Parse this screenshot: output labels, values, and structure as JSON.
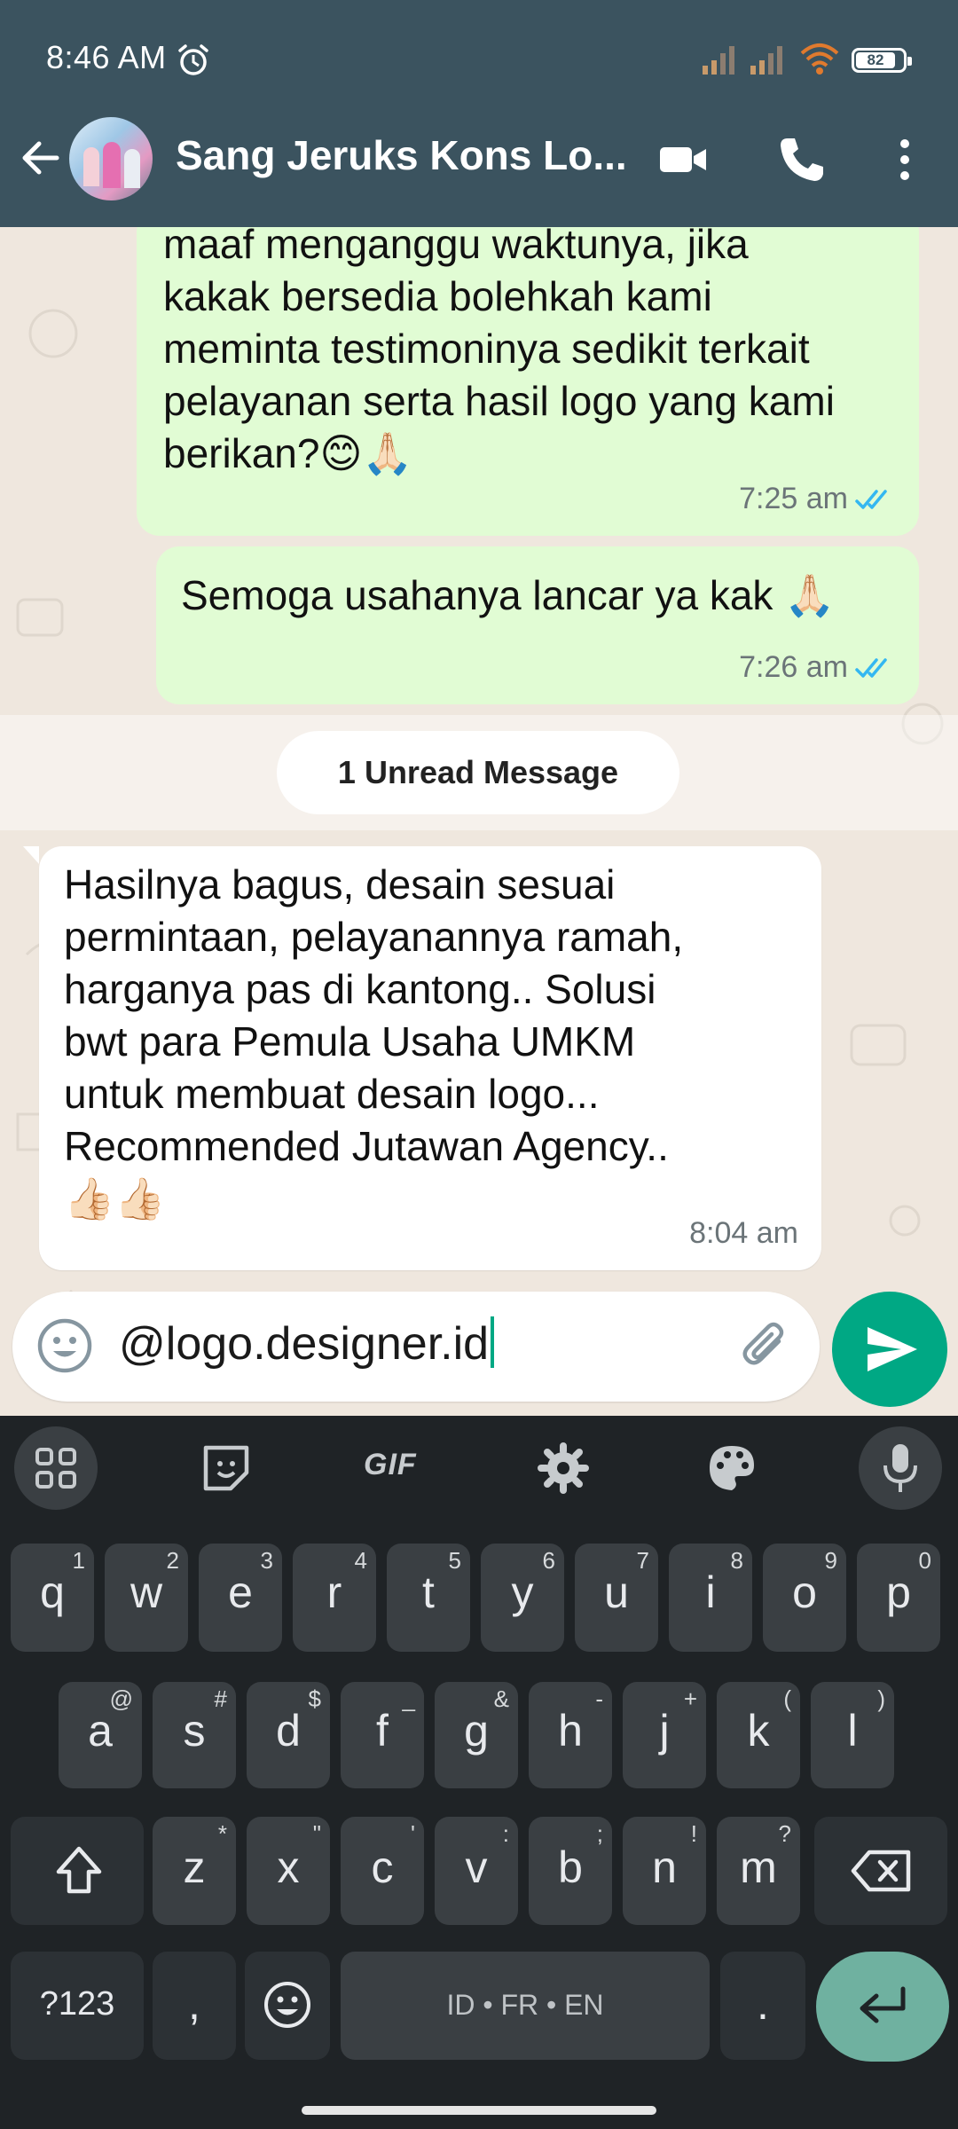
{
  "status_bar": {
    "time": "8:46 AM",
    "battery": "82"
  },
  "header": {
    "title": "Sang Jeruks Kons Lo..."
  },
  "messages": [
    {
      "direction": "out",
      "text": "maaf menganggu waktunya, jika\nkakak bersedia bolehkah kami\nmeminta testimoninya sedikit terkait\npelayanan serta hasil logo yang kami\nberikan?😊🙏🏻",
      "time": "7:25 am"
    },
    {
      "direction": "out",
      "text": "Semoga usahanya lancar ya kak 🙏🏻",
      "time": "7:26 am"
    },
    {
      "direction": "in",
      "text": "Hasilnya bagus, desain sesuai\npermintaan, pelayanannya ramah,\nharganya pas di kantong.. Solusi\nbwt para Pemula Usaha UMKM\nuntuk membuat desain logo...\nRecommended Jutawan Agency..\n👍🏻👍🏻",
      "time": "8:04 am"
    }
  ],
  "unread_banner": "1 Unread Message",
  "composer": {
    "value": "@logo.designer.id"
  },
  "keyboard": {
    "toolbar_gif": "GIF",
    "row1": [
      {
        "k": "q",
        "s": "1"
      },
      {
        "k": "w",
        "s": "2"
      },
      {
        "k": "e",
        "s": "3"
      },
      {
        "k": "r",
        "s": "4"
      },
      {
        "k": "t",
        "s": "5"
      },
      {
        "k": "y",
        "s": "6"
      },
      {
        "k": "u",
        "s": "7"
      },
      {
        "k": "i",
        "s": "8"
      },
      {
        "k": "o",
        "s": "9"
      },
      {
        "k": "p",
        "s": "0"
      }
    ],
    "row2": [
      {
        "k": "a",
        "s": "@"
      },
      {
        "k": "s",
        "s": "#"
      },
      {
        "k": "d",
        "s": "$"
      },
      {
        "k": "f",
        "s": "_"
      },
      {
        "k": "g",
        "s": "&"
      },
      {
        "k": "h",
        "s": "-"
      },
      {
        "k": "j",
        "s": "+"
      },
      {
        "k": "k",
        "s": "("
      },
      {
        "k": "l",
        "s": ")"
      }
    ],
    "row3": [
      {
        "k": "z",
        "s": "*"
      },
      {
        "k": "x",
        "s": "\""
      },
      {
        "k": "c",
        "s": "'"
      },
      {
        "k": "v",
        "s": ":"
      },
      {
        "k": "b",
        "s": ";"
      },
      {
        "k": "n",
        "s": "!"
      },
      {
        "k": "m",
        "s": "?"
      }
    ],
    "symbols_key": "?123",
    "comma_key": ",",
    "space_label": "ID • FR • EN",
    "period_key": "."
  }
}
